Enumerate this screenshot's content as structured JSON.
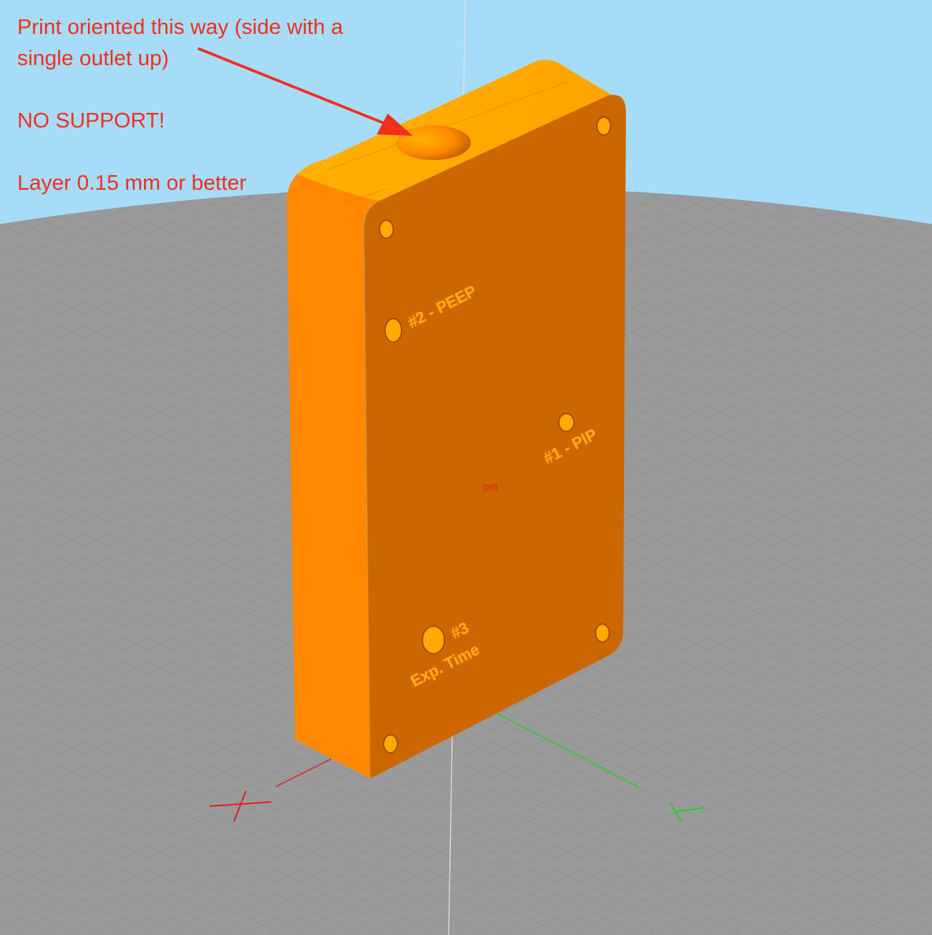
{
  "annotation": {
    "line1": "Print oriented this way (side with a",
    "line2": "single outlet up)",
    "line3": "NO SUPPORT!",
    "line4": "Layer 0.15 mm or better"
  },
  "model": {
    "embossed_labels": {
      "label_2": "#2 - PEEP",
      "label_1": "#1 - PIP",
      "label_3_num": "#3",
      "label_3_name": "Exp. Time"
    },
    "center_label": "prit"
  },
  "colors": {
    "sky": "#a6dcf8",
    "bed": "#9a9a9a",
    "grid_line": "#8a8a8a",
    "model_front": "#cc6600",
    "model_side": "#ff8800",
    "model_top": "#ffaa00",
    "annotation": "#f0301c",
    "axis_x": "#e81818",
    "axis_y": "#16d416"
  },
  "icons": {
    "pointer": "arrow-icon",
    "x_axis": "x-axis-icon",
    "y_axis": "y-axis-icon"
  }
}
